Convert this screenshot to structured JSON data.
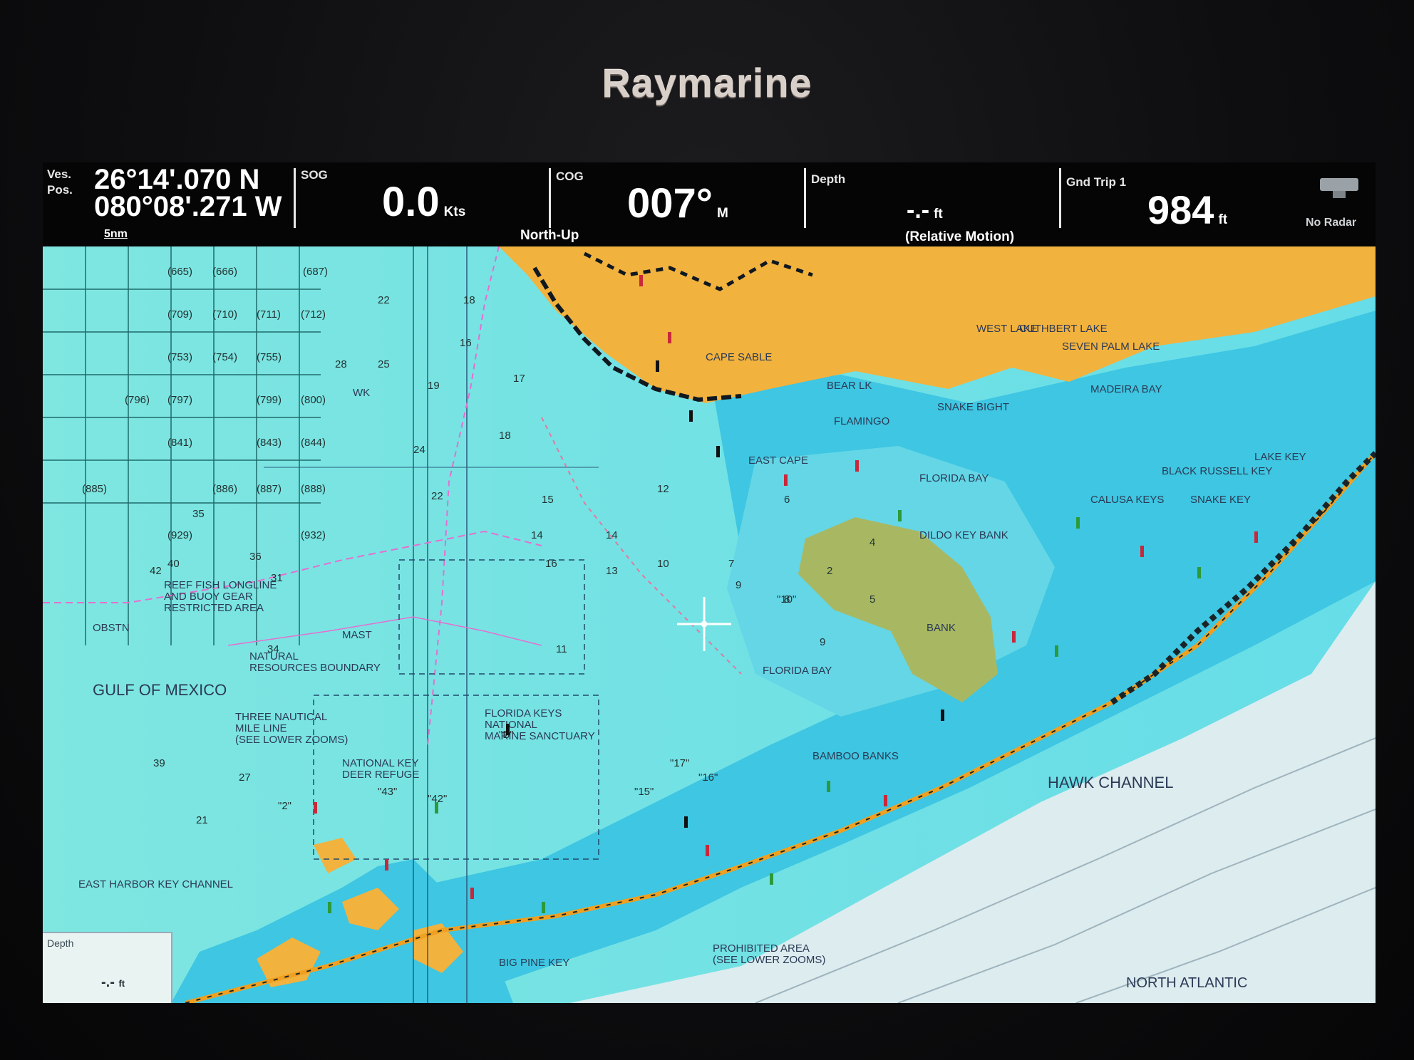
{
  "device": {
    "brand": "Raymarine"
  },
  "databar": {
    "position": {
      "label": "Ves. Pos.",
      "lat": "26°14'.070 N",
      "lon": "080°08'.271 W",
      "scale": "5nm"
    },
    "sog": {
      "label": "SOG",
      "value": "0.0",
      "unit": "Kts"
    },
    "cog": {
      "label": "COG",
      "value": "007°",
      "unit": "M",
      "orientation": "North-Up"
    },
    "depth": {
      "label": "Depth",
      "value": "-.-",
      "unit": "ft",
      "mode": "(Relative Motion)"
    },
    "trip": {
      "label": "Gnd Trip 1",
      "value": "984",
      "unit": "ft"
    },
    "radar": {
      "label": "No Radar",
      "icon": "radar-icon"
    }
  },
  "chart": {
    "colors": {
      "water": "#73e3e6",
      "shallow": "#3fc7e0",
      "land": "#f2b23e",
      "deep": "#dfeff0",
      "marsh": "#a8b862",
      "road": "#f0a020"
    },
    "labels": {
      "cape_sable": "CAPE SABLE",
      "bear_lk": "BEAR LK",
      "flamingo": "FLAMINGO",
      "east_cape": "EAST CAPE",
      "snake_bight": "SNAKE BIGHT",
      "west_lake": "WEST LAKE",
      "cuthbert_lake": "CUTHBERT LAKE",
      "seven_palm_lake": "SEVEN PALM LAKE",
      "madeira_bay": "MADEIRA BAY",
      "florida_bay_n": "FLORIDA BAY",
      "dildo_key_bank": "DILDO KEY BANK",
      "bank": "BANK",
      "calusa_keys": "CALUSA KEYS",
      "black_russell_key": "BLACK RUSSELL KEY",
      "snake_key": "SNAKE KEY",
      "lake_key": "LAKE KEY",
      "florida_bay_s": "FLORIDA BAY",
      "gulf_of_mexico": "GULF OF MEXICO",
      "reef_fish_1": "REEF FISH LONGLINE",
      "reef_fish_2": "AND BUOY GEAR",
      "reef_fish_3": "RESTRICTED AREA",
      "nat_res_1": "NATURAL",
      "nat_res_2": "RESOURCES BOUNDARY",
      "three_naut_1": "THREE NAUTICAL",
      "three_naut_2": "MILE LINE",
      "three_naut_3": "(SEE LOWER ZOOMS)",
      "fk_sanct_1": "FLORIDA KEYS",
      "fk_sanct_2": "NATIONAL",
      "fk_sanct_3": "MARINE SANCTUARY",
      "deer_refuge_1": "NATIONAL KEY",
      "deer_refuge_2": "DEER REFUGE",
      "bamboo_banks": "BAMBOO BANKS",
      "hawk_channel": "HAWK CHANNEL",
      "north_atlantic": "NORTH ATLANTIC",
      "mast": "MAST",
      "obstn": "OBSTN",
      "prohibited_1": "PROHIBITED AREA",
      "prohibited_2": "(SEE LOWER ZOOMS)",
      "big_pine_key": "BIG PINE KEY",
      "east_harbor": "EAST HARBOR KEY CHANNEL",
      "wk": "WK"
    },
    "soundings": [
      "22",
      "18",
      "17",
      "19",
      "16",
      "24",
      "18",
      "15",
      "22",
      "12",
      "14",
      "10",
      "7",
      "9",
      "13",
      "16",
      "14",
      "11",
      "9",
      "6",
      "5",
      "4",
      "2",
      "8",
      "25",
      "28",
      "40",
      "42",
      "31",
      "36",
      "35",
      "34",
      "39",
      "21",
      "27"
    ],
    "markers": {
      "tag10": "\"10\"",
      "tag2": "\"2\"",
      "tagB": "\"B\"",
      "tag15": "\"15\"",
      "tag16": "\"16\"",
      "tag17": "\"17\"",
      "tag42": "\"42\"",
      "tag43": "\"43\""
    },
    "grid_cells": [
      "(665)",
      "(666)",
      "(687)",
      "(709)",
      "(710)",
      "(711)",
      "(712)",
      "(753)",
      "(754)",
      "(755)",
      "(796)",
      "(797)",
      "(799)",
      "(800)",
      "(841)",
      "(843)",
      "(844)",
      "(885)",
      "(886)",
      "(887)",
      "(888)",
      "(929)",
      "(932)"
    ]
  },
  "depth_inset": {
    "label": "Depth",
    "value": "-.-",
    "unit": "ft"
  }
}
